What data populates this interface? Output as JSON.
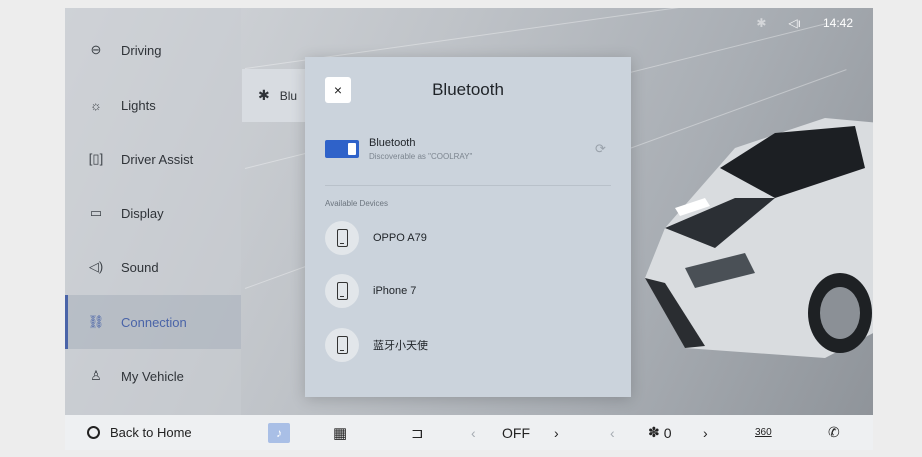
{
  "status": {
    "bluetooth_icon": "bluetooth-icon",
    "volume_icon": "volume-icon",
    "time": "14:42"
  },
  "sidebar": {
    "items": [
      {
        "label": "Driving",
        "icon": "steering-wheel-icon",
        "glyph": "⊖",
        "active": false
      },
      {
        "label": "Lights",
        "icon": "light-bulb-icon",
        "glyph": "☼",
        "active": false
      },
      {
        "label": "Driver Assist",
        "icon": "driver-assist-icon",
        "glyph": "[▯]",
        "active": false
      },
      {
        "label": "Display",
        "icon": "display-icon",
        "glyph": "▭",
        "active": false
      },
      {
        "label": "Sound",
        "icon": "speaker-icon",
        "glyph": "◁)",
        "active": false
      },
      {
        "label": "Connection",
        "icon": "link-icon",
        "glyph": "⛓",
        "active": true
      },
      {
        "label": "My Vehicle",
        "icon": "person-icon",
        "glyph": "♙",
        "active": false
      }
    ]
  },
  "subpanel": {
    "label": "Blu",
    "icon": "bluetooth-icon"
  },
  "modal": {
    "title": "Bluetooth",
    "close_glyph": "×",
    "bluetooth_label": "Bluetooth",
    "discoverable_text": "Discoverable as \"COOLRAY\"",
    "toggle_on": true,
    "available_header": "Available Devices",
    "devices": [
      {
        "name": "OPPO A79"
      },
      {
        "name": "iPhone 7"
      },
      {
        "name": "蓝牙小天使"
      }
    ]
  },
  "bottom_bar": {
    "back_home": "Back to Home",
    "temp_left": "OFF",
    "fan_value": "0",
    "view_360": "360",
    "colors": {
      "accent": "#2f62c9",
      "active_text": "#4a64a8"
    }
  }
}
